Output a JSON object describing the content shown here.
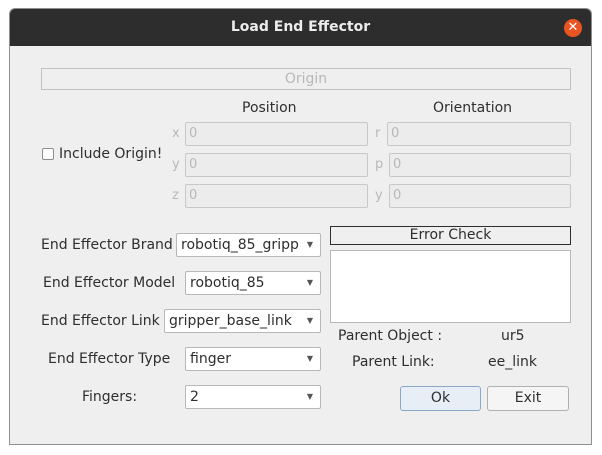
{
  "window": {
    "title": "Load End Effector"
  },
  "origin": {
    "header": "Origin",
    "position_label": "Position",
    "orientation_label": "Orientation",
    "include_label": "Include Origin!",
    "include_checked": false,
    "axes_position": [
      "x",
      "y",
      "z"
    ],
    "axes_orientation": [
      "r",
      "p",
      "y"
    ],
    "position_values": [
      "0",
      "0",
      "0"
    ],
    "orientation_values": [
      "0",
      "0",
      "0"
    ]
  },
  "form": {
    "brand_label": "End Effector Brand",
    "brand_value": "robotiq_85_gripp",
    "model_label": "End Effector Model",
    "model_value": "robotiq_85",
    "link_label": "End Effector Link",
    "link_value": "gripper_base_link",
    "type_label": "End Effector Type",
    "type_value": "finger",
    "fingers_label": "Fingers:",
    "fingers_value": "2"
  },
  "error_check": {
    "header": "Error Check",
    "content": ""
  },
  "parent": {
    "object_label": "Parent Object :",
    "object_value": "ur5",
    "link_label": "Parent Link:",
    "link_value": "ee_link"
  },
  "buttons": {
    "ok": "Ok",
    "exit": "Exit"
  },
  "icons": {
    "close": "close-icon",
    "dropdown": "chevron-down-icon"
  },
  "colors": {
    "titlebar": "#2d2d2d",
    "close": "#e95420",
    "background": "#efefef"
  }
}
